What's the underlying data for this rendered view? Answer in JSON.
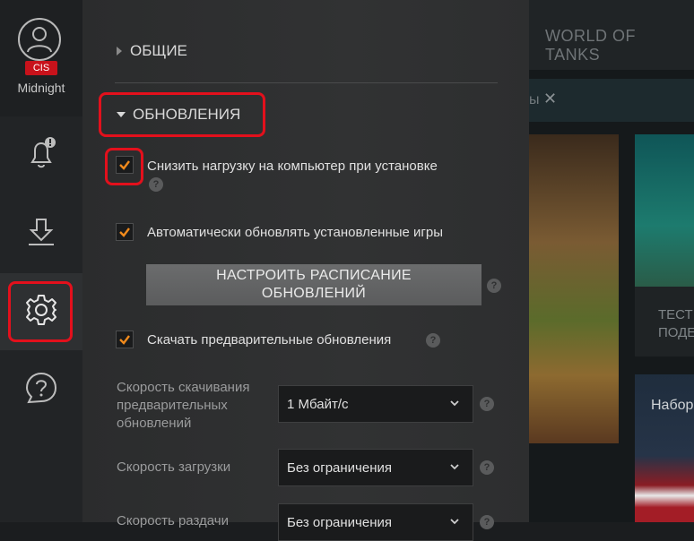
{
  "user": {
    "avatar_icon": "user-icon",
    "region": "CIS",
    "name": "Midnight"
  },
  "rail": {
    "items": [
      {
        "name": "notifications",
        "icon": "bell-icon"
      },
      {
        "name": "downloads",
        "icon": "download-icon"
      },
      {
        "name": "settings",
        "icon": "gear-icon",
        "active": true
      },
      {
        "name": "help",
        "icon": "help-chat-icon"
      }
    ]
  },
  "background": {
    "game_title": "WORLD OF TANKS",
    "search_fragment": "ы",
    "card_text_1": "ТЕСТ",
    "card_text_2": "ПОДЕ",
    "card_text_3": "Набор"
  },
  "settings": {
    "section_general": "ОБЩИЕ",
    "section_updates": "ОБНОВЛЕНИЯ",
    "options": {
      "reduce_load": {
        "label": "Снизить нагрузку на компьютер при установке",
        "checked": true
      },
      "auto_update": {
        "label": "Автоматически обновлять установленные игры",
        "checked": true
      },
      "preload": {
        "label": "Скачать предварительные обновления",
        "checked": true
      }
    },
    "schedule_button": {
      "line1": "НАСТРОИТЬ РАСПИСАНИЕ",
      "line2": "ОБНОВЛЕНИЙ"
    },
    "fields": {
      "preload_speed": {
        "label_line1": "Скорость скачивания",
        "label_line2": "предварительных",
        "label_line3": "обновлений",
        "value": "1 Мбайт/с"
      },
      "download_speed": {
        "label": "Скорость загрузки",
        "value": "Без ограничения"
      },
      "upload_speed": {
        "label": "Скорость раздачи",
        "value": "Без ограничения"
      }
    },
    "help_glyph": "?"
  },
  "colors": {
    "accent_check": "#f08a1c",
    "highlight": "#e3101c",
    "region_badge": "#c8121b"
  }
}
